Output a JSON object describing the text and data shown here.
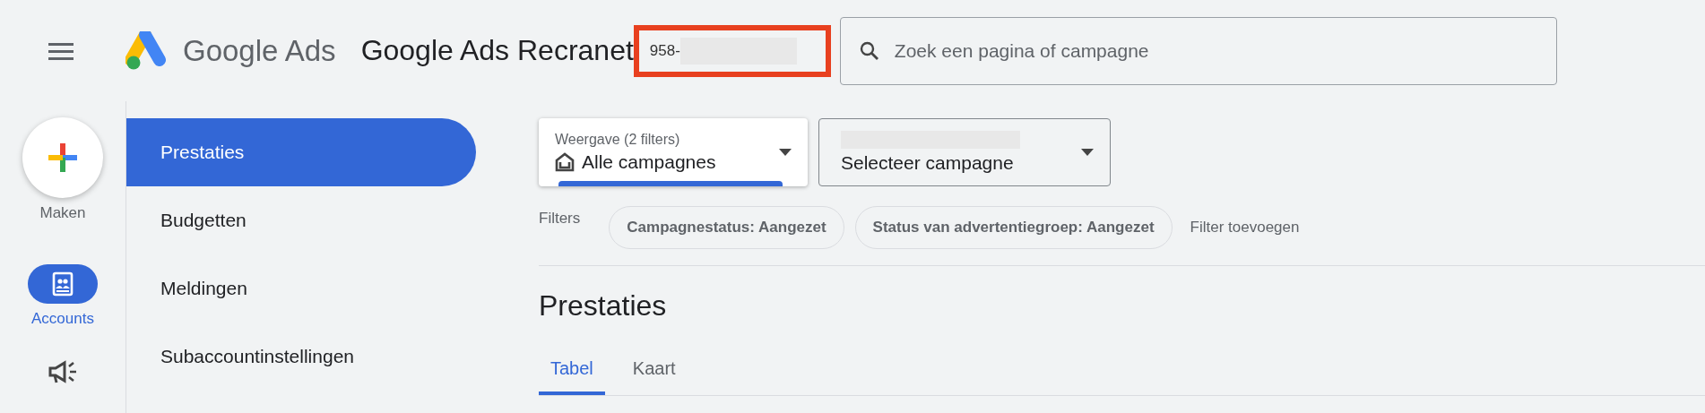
{
  "header": {
    "product": "Google Ads",
    "account_name": "Google Ads Recranet",
    "account_id": "958-",
    "search": {
      "placeholder": "Zoek een pagina of campagne"
    }
  },
  "rail": [
    {
      "kind": "create",
      "label": "Maken",
      "selected": false
    },
    {
      "kind": "accounts",
      "label": "Accounts",
      "selected": true
    },
    {
      "kind": "campaigns",
      "selected": false
    }
  ],
  "nav": [
    {
      "label": "Prestaties",
      "selected": true
    },
    {
      "label": "Budgetten",
      "selected": false
    },
    {
      "label": "Meldingen",
      "selected": false
    },
    {
      "label": "Subaccountinstellingen",
      "selected": false
    }
  ],
  "view_selector": {
    "label": "Weergave (2 filters)",
    "value": "Alle campagnes"
  },
  "campaign_selector": {
    "value": "Selecteer campagne"
  },
  "filters": {
    "label": "Filters",
    "chips": [
      "Campagnestatus: Aangezet",
      "Status van advertentiegroep: Aangezet"
    ],
    "add": "Filter toevoegen"
  },
  "heading": "Prestaties",
  "tabs": [
    {
      "label": "Tabel",
      "selected": true
    },
    {
      "label": "Kaart",
      "selected": false
    }
  ]
}
